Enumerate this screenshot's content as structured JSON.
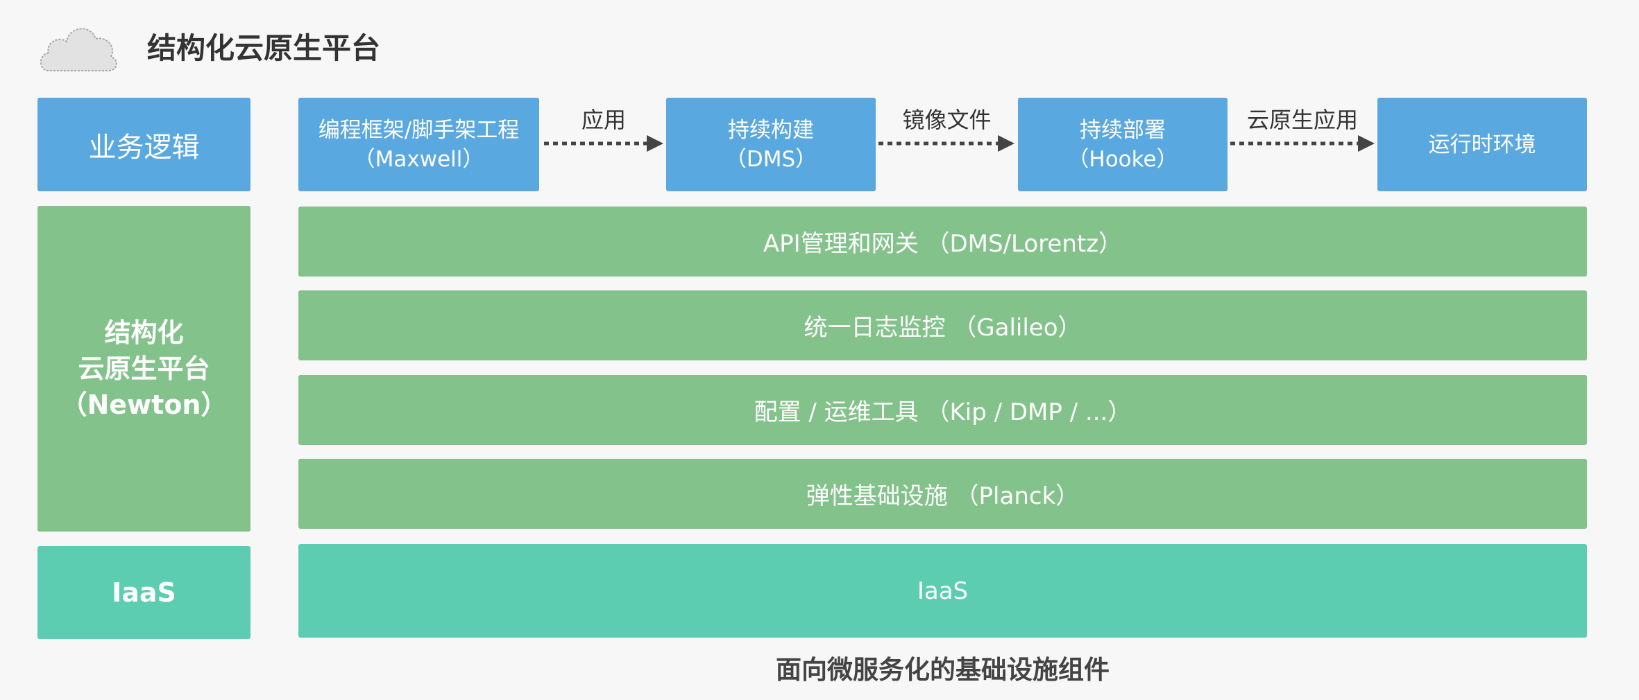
{
  "title": "结构化云原生平台",
  "left_column": {
    "business_logic": "业务逻辑",
    "platform": {
      "line1": "结构化",
      "line2": "云原生平台",
      "line3": "（Newton）"
    },
    "iaas": "IaaS"
  },
  "pipeline": {
    "steps": [
      {
        "line1": "编程框架/脚手架工程",
        "line2": "（Maxwell）"
      },
      {
        "line1": "持续构建",
        "line2": "（DMS）"
      },
      {
        "line1": "持续部署",
        "line2": "（Hooke）"
      },
      {
        "line1": "运行时环境",
        "line2": ""
      }
    ],
    "arrows": [
      "应用",
      "镜像文件",
      "云原生应用"
    ]
  },
  "layers": [
    "API管理和网关 （DMS/Lorentz）",
    "统一日志监控 （Galileo）",
    "配置 / 运维工具 （Kip / DMP / ...）",
    "弹性基础设施 （Planck）"
  ],
  "iaas_bar": "IaaS",
  "caption": "面向微服务化的基础设施组件",
  "colors": {
    "blue": "#5aa8e0",
    "green": "#84c28b",
    "teal": "#5ccdb0",
    "background": "#f7f7f7"
  },
  "icons": [
    "cloud-icon"
  ]
}
